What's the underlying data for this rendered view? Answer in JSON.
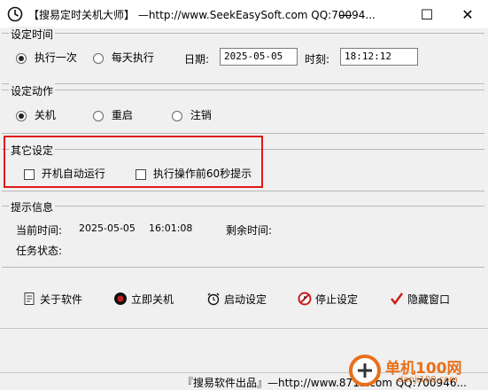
{
  "window": {
    "title": "【搜易定时关机大师】 —http://www.SeekEasySoft.com QQ:70094...",
    "minimize": "—",
    "maximize": "☐",
    "close": "✕"
  },
  "schedule": {
    "legend": "设定时间",
    "option_once": "执行一次",
    "option_daily": "每天执行",
    "date_label": "日期:",
    "date_value": "2025-05-05",
    "time_label": "时刻:",
    "time_value": "18:12:12"
  },
  "action": {
    "legend": "设定动作",
    "shutdown": "关机",
    "restart": "重启",
    "logoff": "注销"
  },
  "other": {
    "legend": "其它设定",
    "autostart": "开机自动运行",
    "notify": "执行操作前60秒提示"
  },
  "info": {
    "legend": "提示信息",
    "current_time_label": "当前时间:",
    "current_date": "2025-05-05",
    "current_time": "16:01:08",
    "remaining_label": "剩余时间:",
    "task_status_label": "任务状态:"
  },
  "buttons": {
    "about": "关于软件",
    "shutdown_now": "立即关机",
    "start": "启动设定",
    "stop": "停止设定",
    "hide": "隐藏窗口"
  },
  "statusbar": {
    "text": "『搜易软件出品』—http://www.8715.com  QQ:700946..."
  },
  "watermark": {
    "text": "单机100网",
    "url": "danji100.com"
  }
}
